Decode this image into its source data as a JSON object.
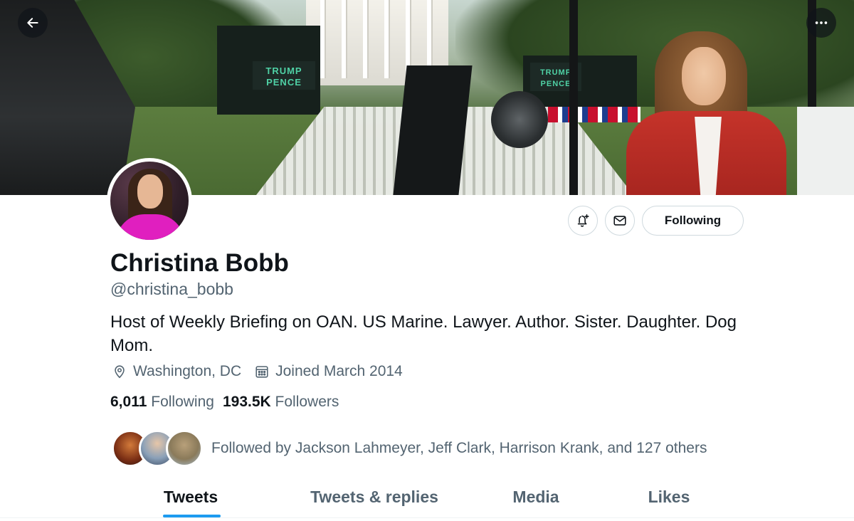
{
  "banner": {
    "sign_left": "TRUMP PENCE",
    "sign_right": "TRUMP PENCE"
  },
  "profile": {
    "name": "Christina Bobb",
    "handle": "@christina_bobb",
    "bio": "Host of Weekly Briefing on OAN. US Marine. Lawyer. Author. Sister. Daughter. Dog Mom.",
    "location": "Washington, DC",
    "joined": "Joined March 2014",
    "following_count": "6,011",
    "following_label": "Following",
    "followers_count": "193.5K",
    "followers_label": "Followers",
    "followed_by": "Followed by Jackson Lahmeyer, Jeff Clark, Harrison Krank, and 127 others"
  },
  "actions": {
    "following_button": "Following",
    "notify_icon": "bell-plus-icon",
    "message_icon": "envelope-icon"
  },
  "tabs": [
    {
      "label": "Tweets",
      "active": true
    },
    {
      "label": "Tweets & replies",
      "active": false
    },
    {
      "label": "Media",
      "active": false
    },
    {
      "label": "Likes",
      "active": false
    }
  ],
  "colors": {
    "accent": "#1d9bf0",
    "text_primary": "#0f1419",
    "text_secondary": "#536471",
    "border": "#cfd9de"
  }
}
